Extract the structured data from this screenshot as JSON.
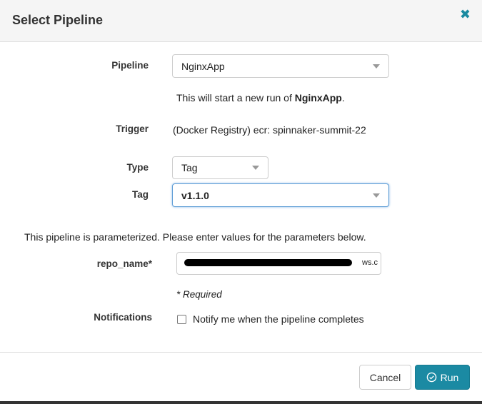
{
  "dialog": {
    "title": "Select Pipeline",
    "close_icon": "close-icon"
  },
  "pipeline": {
    "label": "Pipeline",
    "value": "NginxApp",
    "info_prefix": "This will start a new run of ",
    "info_name": "NginxApp",
    "info_suffix": "."
  },
  "trigger": {
    "label": "Trigger",
    "value": "(Docker Registry) ecr: spinnaker-summit-22"
  },
  "type": {
    "label": "Type",
    "value": "Tag"
  },
  "tag": {
    "label": "Tag",
    "value": "v1.1.0"
  },
  "parameters": {
    "intro": "This pipeline is parameterized. Please enter values for the parameters below.",
    "repo_name_label": "repo_name*",
    "repo_name_visible_suffix": "ws.c",
    "required_note": "* Required"
  },
  "notifications": {
    "label": "Notifications",
    "checkbox_label": "Notify me when the pipeline completes",
    "checked": false
  },
  "footer": {
    "cancel_label": "Cancel",
    "run_label": "Run"
  },
  "colors": {
    "accent": "#1b8aa3"
  }
}
